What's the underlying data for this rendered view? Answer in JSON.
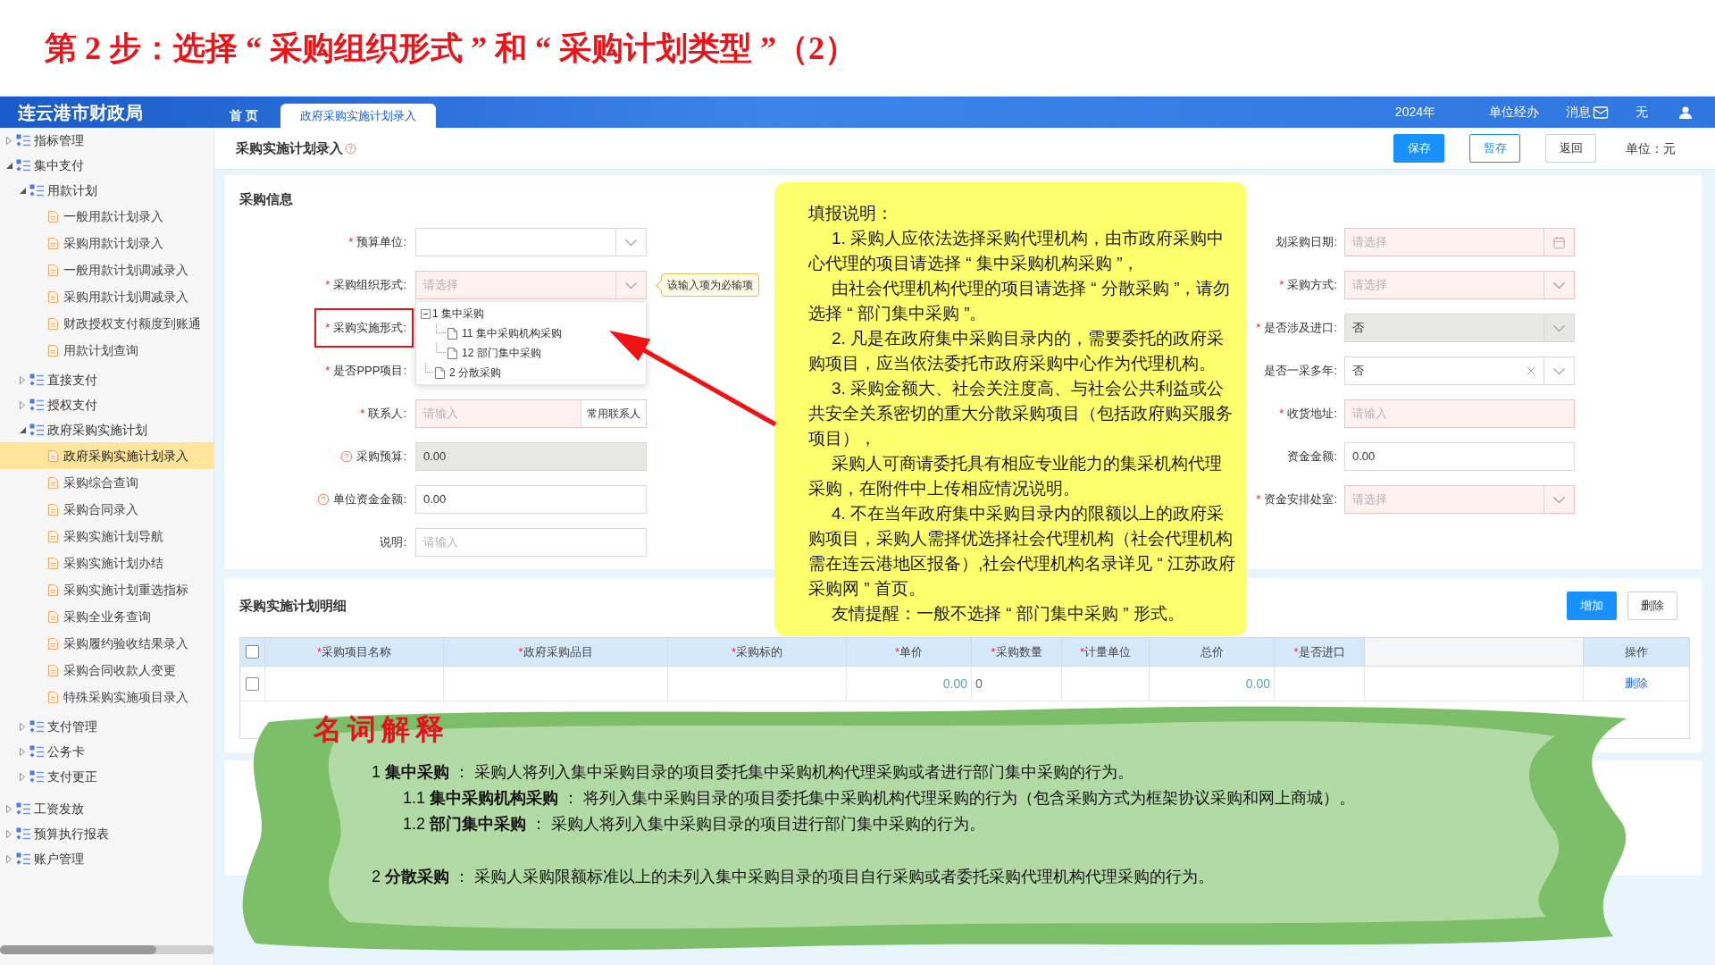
{
  "slide_title": "第 2 步：选择 “ 采购组织形式 ” 和 “ 采购计划类型 ”（2）",
  "header": {
    "app_title": "连云港市财政局",
    "tabs": [
      {
        "label": "首页",
        "selected": false
      },
      {
        "label": "政府采购实施计划录入",
        "selected": true
      }
    ],
    "year": "2024年",
    "role": "单位经办",
    "messages": "消息",
    "user": "无"
  },
  "sidebar": {
    "items": [
      {
        "label": "指标管理",
        "kind": "group",
        "expanded": false,
        "selected": false
      },
      {
        "label": "集中支付",
        "kind": "group",
        "expanded": true,
        "selected": false,
        "children": [
          {
            "label": "用款计划",
            "kind": "group",
            "expanded": true,
            "selected": false,
            "children": [
              {
                "label": "一般用款计划录入",
                "kind": "page",
                "selected": false
              },
              {
                "label": "采购用款计划录入",
                "kind": "page",
                "selected": false
              },
              {
                "label": "一般用款计划调减录入",
                "kind": "page",
                "selected": false
              },
              {
                "label": "采购用款计划调减录入",
                "kind": "page",
                "selected": false
              },
              {
                "label": "财政授权支付额度到账通",
                "kind": "page",
                "selected": false
              },
              {
                "label": "用款计划查询",
                "kind": "page",
                "selected": false
              }
            ]
          },
          {
            "label": "直接支付",
            "kind": "group",
            "expanded": false,
            "selected": false
          },
          {
            "label": "授权支付",
            "kind": "group",
            "expanded": false,
            "selected": false
          },
          {
            "label": "政府采购实施计划",
            "kind": "group",
            "expanded": true,
            "selected": false,
            "children": [
              {
                "label": "政府采购实施计划录入",
                "kind": "page",
                "selected": true
              },
              {
                "label": "采购综合查询",
                "kind": "page",
                "selected": false
              },
              {
                "label": "采购合同录入",
                "kind": "page",
                "selected": false
              },
              {
                "label": "采购实施计划导航",
                "kind": "page",
                "selected": false
              },
              {
                "label": "采购实施计划办结",
                "kind": "page",
                "selected": false
              },
              {
                "label": "采购实施计划重选指标",
                "kind": "page",
                "selected": false
              },
              {
                "label": "采购全业务查询",
                "kind": "page",
                "selected": false
              },
              {
                "label": "采购履约验收结果录入",
                "kind": "page",
                "selected": false
              },
              {
                "label": "采购合同收款人变更",
                "kind": "page",
                "selected": false
              },
              {
                "label": "特殊采购实施项目录入",
                "kind": "page",
                "selected": false
              }
            ]
          },
          {
            "label": "支付管理",
            "kind": "group",
            "expanded": false,
            "selected": false
          },
          {
            "label": "公务卡",
            "kind": "group",
            "expanded": false,
            "selected": false
          },
          {
            "label": "支付更正",
            "kind": "group",
            "expanded": false,
            "selected": false
          }
        ]
      },
      {
        "label": "工资发放",
        "kind": "group",
        "expanded": false,
        "selected": false
      },
      {
        "label": "预算执行报表",
        "kind": "group",
        "expanded": false,
        "selected": false
      },
      {
        "label": "账户管理",
        "kind": "group",
        "expanded": false,
        "selected": false
      }
    ]
  },
  "page": {
    "title": "采购实施计划录入",
    "buttons": [
      {
        "label": "保存",
        "kind": "primary"
      },
      {
        "label": "暂存",
        "kind": "outline"
      },
      {
        "label": "返回",
        "kind": "default"
      }
    ],
    "unit": "单位：元"
  },
  "form": {
    "title": "采购信息",
    "left": [
      {
        "mark": "*",
        "label": "预算单位:",
        "help": false,
        "highlighted": false,
        "kind": "select",
        "invalid": false,
        "disabled": false
      },
      {
        "mark": "*",
        "label": "采购组织形式:",
        "help": false,
        "highlighted": false,
        "kind": "select",
        "invalid": true,
        "disabled": false,
        "placeholder": "请选择",
        "tooltip": "该输入项为必输项",
        "dropdown": [
          {
            "label": "1 集中采购",
            "expanded": true,
            "selected": false,
            "children": [
              {
                "label": "11 集中采购机构采购",
                "selected": false
              },
              {
                "label": "12 部门集中采购",
                "selected": false
              }
            ]
          },
          {
            "label": "2 分散采购",
            "selected": false
          }
        ]
      },
      {
        "mark": "*",
        "label": "采购实施形式:",
        "help": false,
        "highlighted": true
      },
      {
        "mark": "*",
        "label": "是否PPP项目:",
        "help": false,
        "highlighted": false
      },
      {
        "mark": "*",
        "label": "联系人:",
        "help": false,
        "highlighted": false,
        "kind": "input",
        "invalid": true,
        "disabled": false,
        "placeholder": "请输入",
        "button": "常用联系人"
      },
      {
        "label": "采购预算:",
        "help": true,
        "highlighted": false,
        "kind": "input",
        "invalid": false,
        "disabled": true,
        "value": "0.00"
      },
      {
        "label": "单位资金金额:",
        "help": true,
        "highlighted": false,
        "kind": "input",
        "invalid": false,
        "disabled": false,
        "value": "0.00"
      },
      {
        "label": "说明:",
        "help": false,
        "highlighted": false,
        "kind": "input",
        "invalid": false,
        "disabled": false,
        "placeholder": "请输入"
      }
    ],
    "right": [
      {
        "label": "划采购日期:",
        "help": false,
        "highlighted": false,
        "kind": "date",
        "invalid": true,
        "disabled": false,
        "placeholder": "请选择"
      },
      {
        "mark": "*",
        "label": "采购方式:",
        "help": false,
        "highlighted": false,
        "kind": "select",
        "invalid": true,
        "disabled": false,
        "placeholder": "请选择"
      },
      {
        "mark": "*",
        "label": "是否涉及进口:",
        "help": false,
        "highlighted": false,
        "kind": "select",
        "invalid": false,
        "disabled": true,
        "value": "否"
      },
      {
        "label": "是否一采多年:",
        "help": false,
        "highlighted": false,
        "kind": "clearable-select",
        "invalid": false,
        "disabled": false,
        "value": "否"
      },
      {
        "mark": "*",
        "label": "收货地址:",
        "help": false,
        "highlighted": false,
        "kind": "input",
        "invalid": true,
        "disabled": false,
        "placeholder": "请输入"
      },
      {
        "label": "资金金额:",
        "help": false,
        "highlighted": false,
        "kind": "input",
        "invalid": false,
        "disabled": false,
        "value": "0.00"
      },
      {
        "mark": "*",
        "label": "资金安排处室:",
        "help": false,
        "highlighted": false,
        "kind": "select",
        "invalid": true,
        "disabled": false,
        "placeholder": "请选择"
      }
    ]
  },
  "details": {
    "title": "采购实施计划明细",
    "buttons": [
      {
        "label": "增加",
        "kind": "primary"
      },
      {
        "label": "删除",
        "kind": "default"
      }
    ],
    "table": {
      "select_all": {
        "checked": false
      },
      "columns": [
        {
          "mark": "*",
          "label": "采购项目名称",
          "kind": "text"
        },
        {
          "mark": "*",
          "label": "政府采购品目",
          "kind": "text"
        },
        {
          "mark": "*",
          "label": "采购标的",
          "kind": "text"
        },
        {
          "mark": "*",
          "label": "单价",
          "kind": "number"
        },
        {
          "mark": "*",
          "label": "采购数量",
          "kind": "text"
        },
        {
          "mark": "*",
          "label": "计量单位",
          "kind": "text"
        },
        {
          "label": "总价",
          "kind": "number"
        },
        {
          "mark": "*",
          "label": "是否进口",
          "kind": "text"
        },
        {
          "kind": "spacer"
        }
      ],
      "action_column": "操作",
      "rows": [
        {
          "checked": false,
          "cells": [
            null,
            null,
            null,
            "0.00",
            "0",
            null,
            "0.00",
            null,
            null
          ],
          "action": "删除"
        }
      ]
    }
  },
  "note": {
    "title": "填报说明：",
    "paragraphs": [
      "1. 采购人应依法选择采购代理机构，由市政府采购中心代理的项目请选择 “ 集中采购机构采购 ”，",
      "由社会代理机构代理的项目请选择 “ 分散采购 ”，请勿选择 “ 部门集中采购 ”。",
      "2. 凡是在政府集中采购目录内的，需要委托的政府采购项目，应当依法委托市政府采购中心作为代理机构。",
      "3. 采购金额大、社会关注度高、与社会公共利益或公共安全关系密切的重大分散采购项目（包括政府购买服务项目），",
      "采购人可商请委托具有相应专业能力的集采机构代理采购，在附件中上传相应情况说明。",
      "4. 不在当年政府集中采购目录内的限额以上的政府采购项目，采购人需择优选择社会代理机构（社会代理机构需在连云港地区报备）,社会代理机构名录详见 “ 江苏政府采购网 ” 首页。",
      "友情提醒：一般不选择 “ 部门集中采购 ” 形式。"
    ]
  },
  "glossary": {
    "title": "名词解释",
    "entries": [
      {
        "text": "1 **集中采购** ： 采购人将列入集中采购目录的项目委托集中采购机构代理采购或者进行部门集中采购的行为。",
        "children": [
          {
            "text": "1.1 **集中采购机构采购** ： 将列入集中采购目录的项目委托集中采购机构代理采购的行为（包含采购方式为框架协议采购和网上商城）。"
          },
          {
            "text": "1.2 **部门集中采购** ： 采购人将列入集中采购目录的项目进行部门集中采购的行为。"
          }
        ]
      },
      {
        "text": "2 **分散采购** ： 采购人采购限额标准以上的未列入集中采购目录的项目自行采购或者委托采购代理机构代理采购的行为。"
      }
    ]
  }
}
